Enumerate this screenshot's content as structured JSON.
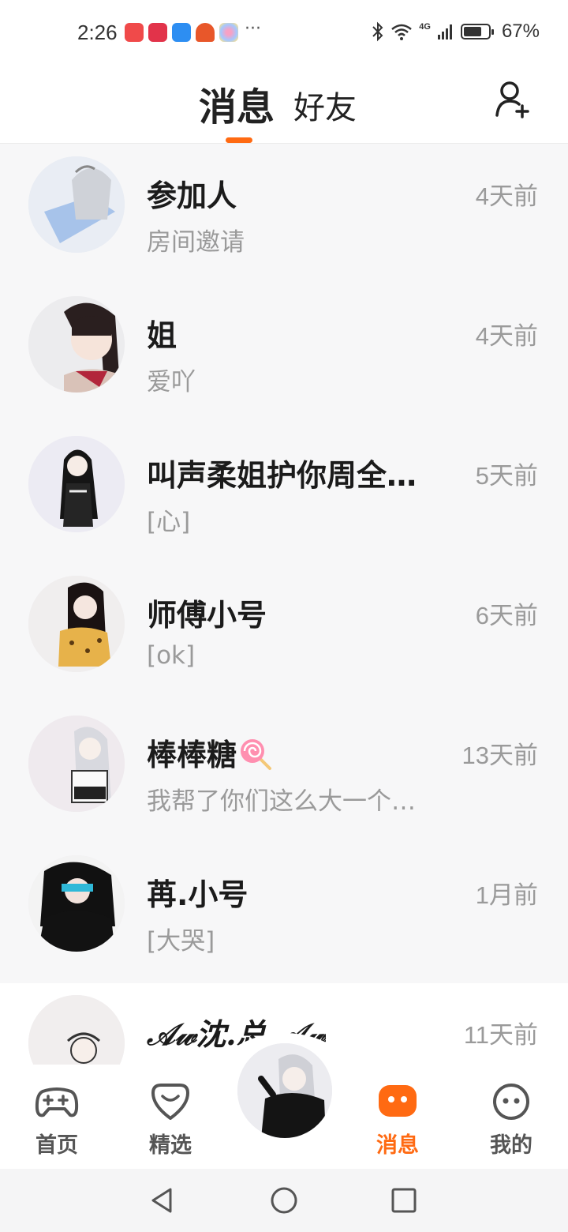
{
  "status_bar": {
    "time": "2:26",
    "more": "···",
    "network": "4G",
    "battery": "67%",
    "battery_level_pct": 67
  },
  "header": {
    "tabs": [
      {
        "label": "消息",
        "active": true
      },
      {
        "label": "好友",
        "active": false
      }
    ],
    "accent_color": "#ff6a12"
  },
  "conversations": [
    {
      "name": "参加人",
      "time": "4天前",
      "preview": "房间邀请"
    },
    {
      "name": "姐",
      "time": "4天前",
      "preview": "爱吖"
    },
    {
      "name": "叫声柔姐护你周全…",
      "time": "5天前",
      "preview": "[心]"
    },
    {
      "name": "师傅小号",
      "time": "6天前",
      "preview": "[ok]"
    },
    {
      "name": "棒棒糖",
      "time": "13天前",
      "preview": "我帮了你们这么大一个…",
      "emoji": "lollipop-icon"
    },
    {
      "name": "苒.小号",
      "time": "1月前",
      "preview": "[大哭]"
    },
    {
      "name": "𝒜𝓌沈.总.𝒜𝓌",
      "time": "11天前",
      "preview": ""
    }
  ],
  "bottom_nav": {
    "items": [
      {
        "label": "首页",
        "icon": "gamepad-icon",
        "active": false
      },
      {
        "label": "精选",
        "icon": "heart-badge-icon",
        "active": false
      },
      {
        "label": "消息",
        "icon": "chat-bubble-icon",
        "active": true
      },
      {
        "label": "我的",
        "icon": "face-icon",
        "active": false
      }
    ]
  }
}
